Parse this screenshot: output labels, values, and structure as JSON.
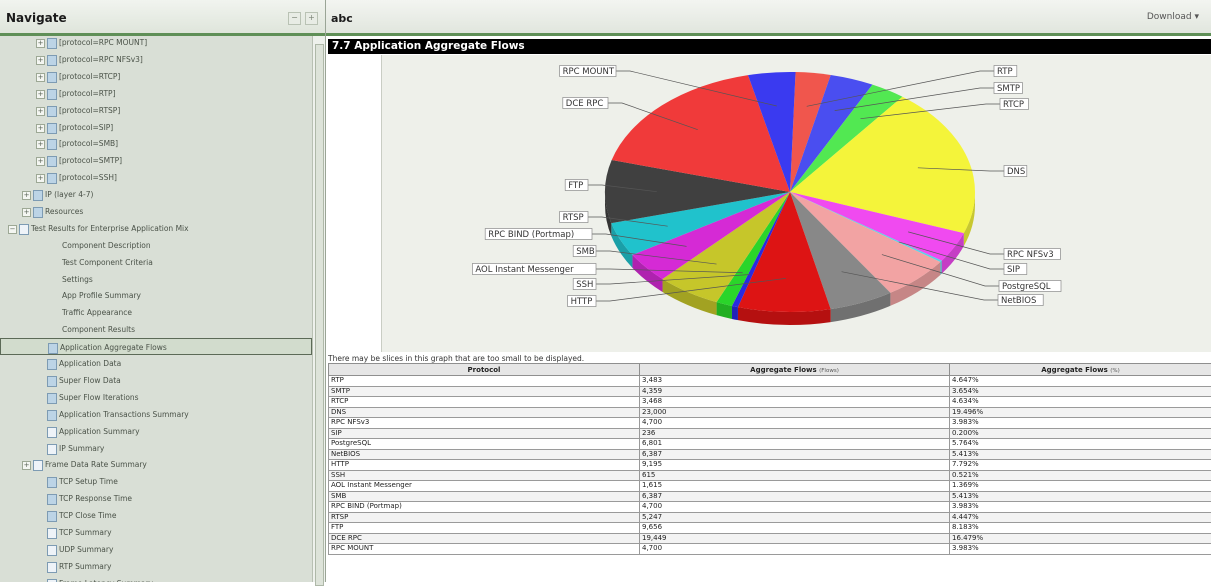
{
  "nav": {
    "title": "Navigate",
    "items": [
      {
        "label": "[protocol=RPC MOUNT]",
        "indent": 2,
        "exp": "+",
        "icon": "folder"
      },
      {
        "label": "[protocol=RPC NFSv3]",
        "indent": 2,
        "exp": "+",
        "icon": "folder"
      },
      {
        "label": "[protocol=RTCP]",
        "indent": 2,
        "exp": "+",
        "icon": "folder"
      },
      {
        "label": "[protocol=RTP]",
        "indent": 2,
        "exp": "+",
        "icon": "folder"
      },
      {
        "label": "[protocol=RTSP]",
        "indent": 2,
        "exp": "+",
        "icon": "folder"
      },
      {
        "label": "[protocol=SIP]",
        "indent": 2,
        "exp": "+",
        "icon": "folder"
      },
      {
        "label": "[protocol=SMB]",
        "indent": 2,
        "exp": "+",
        "icon": "folder"
      },
      {
        "label": "[protocol=SMTP]",
        "indent": 2,
        "exp": "+",
        "icon": "folder"
      },
      {
        "label": "[protocol=SSH]",
        "indent": 2,
        "exp": "+",
        "icon": "folder"
      },
      {
        "label": "IP (layer 4-7)",
        "indent": 1,
        "exp": "+",
        "icon": "folder"
      },
      {
        "label": "Resources",
        "indent": 1,
        "exp": "+",
        "icon": "folder"
      },
      {
        "label": "Test Results for Enterprise Application Mix",
        "indent": 0,
        "exp": "−",
        "icon": "doc"
      },
      {
        "label": "Component Description",
        "indent": 3,
        "exp": "",
        "icon": ""
      },
      {
        "label": "Test Component Criteria",
        "indent": 3,
        "exp": "",
        "icon": ""
      },
      {
        "label": "Settings",
        "indent": 3,
        "exp": "",
        "icon": ""
      },
      {
        "label": "App Profile Summary",
        "indent": 3,
        "exp": "",
        "icon": ""
      },
      {
        "label": "Traffic Appearance",
        "indent": 3,
        "exp": "",
        "icon": ""
      },
      {
        "label": "Component Results",
        "indent": 3,
        "exp": "",
        "icon": ""
      },
      {
        "label": "Application Aggregate Flows",
        "indent": 2,
        "exp": "",
        "icon": "folder",
        "selected": true
      },
      {
        "label": "Application Data",
        "indent": 2,
        "exp": "",
        "icon": "folder"
      },
      {
        "label": "Super Flow Data",
        "indent": 2,
        "exp": "",
        "icon": "folder"
      },
      {
        "label": "Super Flow Iterations",
        "indent": 2,
        "exp": "",
        "icon": "folder"
      },
      {
        "label": "Application Transactions Summary",
        "indent": 2,
        "exp": "",
        "icon": "folder"
      },
      {
        "label": "Application Summary",
        "indent": 2,
        "exp": "",
        "icon": "doc"
      },
      {
        "label": "IP Summary",
        "indent": 2,
        "exp": "",
        "icon": "doc"
      },
      {
        "label": "Frame Data Rate Summary",
        "indent": 1,
        "exp": "+",
        "icon": "doc"
      },
      {
        "label": "TCP Setup Time",
        "indent": 2,
        "exp": "",
        "icon": "folder"
      },
      {
        "label": "TCP Response Time",
        "indent": 2,
        "exp": "",
        "icon": "folder"
      },
      {
        "label": "TCP Close Time",
        "indent": 2,
        "exp": "",
        "icon": "folder"
      },
      {
        "label": "TCP Summary",
        "indent": 2,
        "exp": "",
        "icon": "doc"
      },
      {
        "label": "UDP Summary",
        "indent": 2,
        "exp": "",
        "icon": "doc"
      },
      {
        "label": "RTP Summary",
        "indent": 2,
        "exp": "",
        "icon": "doc"
      },
      {
        "label": "Frame Latency Summary",
        "indent": 2,
        "exp": "",
        "icon": "doc"
      }
    ]
  },
  "main": {
    "title": "abc",
    "download_label": "Download ▾",
    "section_title": "7.7 Application Aggregate Flows",
    "note": "There may be slices in this graph that are too small to be displayed."
  },
  "table": {
    "headers": [
      "Protocol",
      "Aggregate Flows",
      "Aggregate Flows"
    ],
    "header_units": [
      "",
      "(Flows)",
      "(%)"
    ]
  },
  "chart_data": {
    "type": "pie",
    "title": "",
    "series": [
      {
        "label": "RTP",
        "flows": "3,483",
        "pct": "4.647%",
        "value": 3483,
        "color": "#f0564d"
      },
      {
        "label": "SMTP",
        "flows": "4,359",
        "pct": "3.654%",
        "value": 4359,
        "color": "#4a4ef0"
      },
      {
        "label": "RTCP",
        "flows": "3,468",
        "pct": "4.634%",
        "value": 3468,
        "color": "#52e852"
      },
      {
        "label": "DNS",
        "flows": "23,000",
        "pct": "19.496%",
        "value": 23000,
        "color": "#f4f43a"
      },
      {
        "label": "RPC NFSv3",
        "flows": "4,700",
        "pct": "3.983%",
        "value": 4700,
        "color": "#f04af0"
      },
      {
        "label": "SIP",
        "flows": "236",
        "pct": "0.200%",
        "value": 236,
        "color": "#5ad3e6"
      },
      {
        "label": "PostgreSQL",
        "flows": "6,801",
        "pct": "5.764%",
        "value": 6801,
        "color": "#f2a3a3"
      },
      {
        "label": "NetBIOS",
        "flows": "6,387",
        "pct": "5.413%",
        "value": 6387,
        "color": "#888888"
      },
      {
        "label": "HTTP",
        "flows": "9,195",
        "pct": "7.792%",
        "value": 9195,
        "color": "#dd1414"
      },
      {
        "label": "SSH",
        "flows": "615",
        "pct": "0.521%",
        "value": 615,
        "color": "#2a2ae0"
      },
      {
        "label": "AOL Instant Messenger",
        "flows": "1,615",
        "pct": "1.369%",
        "value": 1615,
        "color": "#2ad52a"
      },
      {
        "label": "SMB",
        "flows": "6,387",
        "pct": "5.413%",
        "value": 6387,
        "color": "#c6c62a"
      },
      {
        "label": "RPC BIND (Portmap)",
        "flows": "4,700",
        "pct": "3.983%",
        "value": 4700,
        "color": "#d52ad5"
      },
      {
        "label": "RTSP",
        "flows": "5,247",
        "pct": "4.447%",
        "value": 5247,
        "color": "#20c2cc"
      },
      {
        "label": "FTP",
        "flows": "9,656",
        "pct": "8.183%",
        "value": 9656,
        "color": "#404040"
      },
      {
        "label": "DCE RPC",
        "flows": "19,449",
        "pct": "16.479%",
        "value": 19449,
        "color": "#f03a3a"
      },
      {
        "label": "RPC MOUNT",
        "flows": "4,700",
        "pct": "3.983%",
        "value": 4700,
        "color": "#3a3af0"
      }
    ]
  }
}
